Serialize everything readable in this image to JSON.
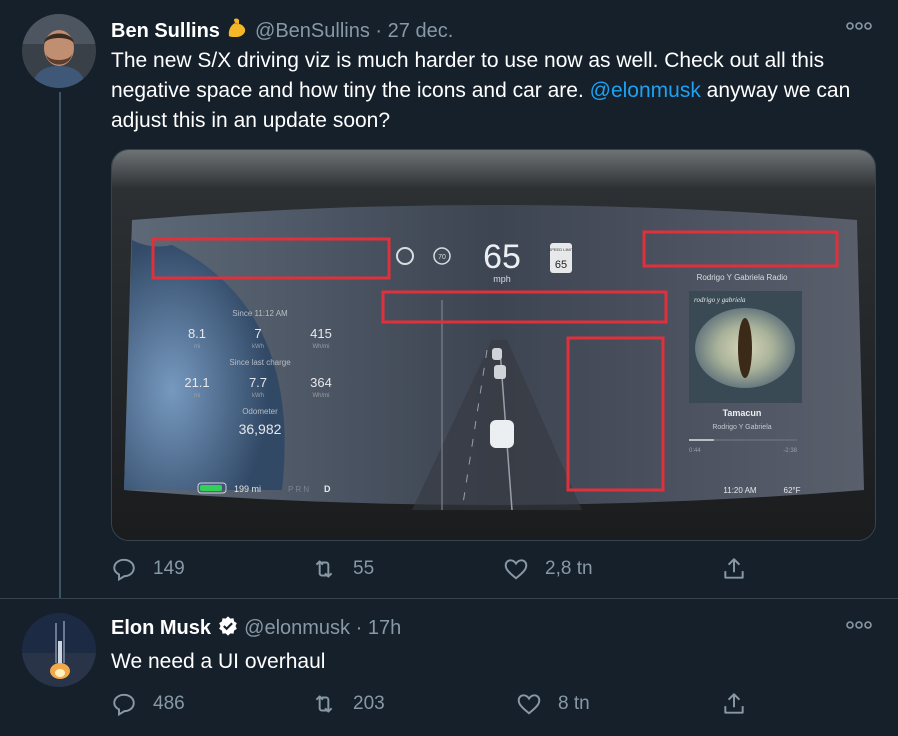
{
  "tweet1": {
    "name": "Ben Sullins",
    "handle": "@BenSullins",
    "sep": "·",
    "date": "27 dec.",
    "text_before": "The new S/X driving viz is much harder to use now as well. Check out all this negative space and how tiny the icons and car are. ",
    "mention": "@elonmusk",
    "text_after": " anyway we can adjust this in an update soon?",
    "more": "ooo",
    "replies": "149",
    "retweets": "55",
    "likes": "2,8 tn",
    "dash": {
      "speed": "65",
      "unit": "mph",
      "set_speed": "70",
      "speed_limit_title": "SPEED LIMIT",
      "speed_limit": "65",
      "since_time": "Since 11:12 AM",
      "stats1": [
        {
          "v": "8.1",
          "u": "mi"
        },
        {
          "v": "7",
          "u": "kWh"
        },
        {
          "v": "415",
          "u": "Wh/mi"
        }
      ],
      "since_charge": "Since last charge",
      "stats2": [
        {
          "v": "21.1",
          "u": "mi"
        },
        {
          "v": "7.7",
          "u": "kWh"
        },
        {
          "v": "364",
          "u": "Wh/mi"
        }
      ],
      "odometer_label": "Odometer",
      "odometer": "36,982",
      "range": "199 mi",
      "gear": "P R N",
      "gear_active": "D",
      "radio": "Rodrigo Y Gabriela Radio",
      "album_text": "rodrigo y gabriela",
      "song": "Tamacun",
      "artist": "Rodrigo Y Gabriela",
      "elapsed": "0:44",
      "remaining": "-2:38",
      "clock": "11:20 AM",
      "temp": "62°F",
      "progress": 0.23
    }
  },
  "tweet2": {
    "name": "Elon Musk",
    "handle": "@elonmusk",
    "sep": "·",
    "date": "17h",
    "text": "We need a UI overhaul",
    "more": "ooo",
    "replies": "486",
    "retweets": "203",
    "likes": "8 tn"
  },
  "colors": {
    "background": "#15202b",
    "muted": "#8899a6",
    "accent": "#1da1f2",
    "highlight_box": "#e0303b"
  }
}
